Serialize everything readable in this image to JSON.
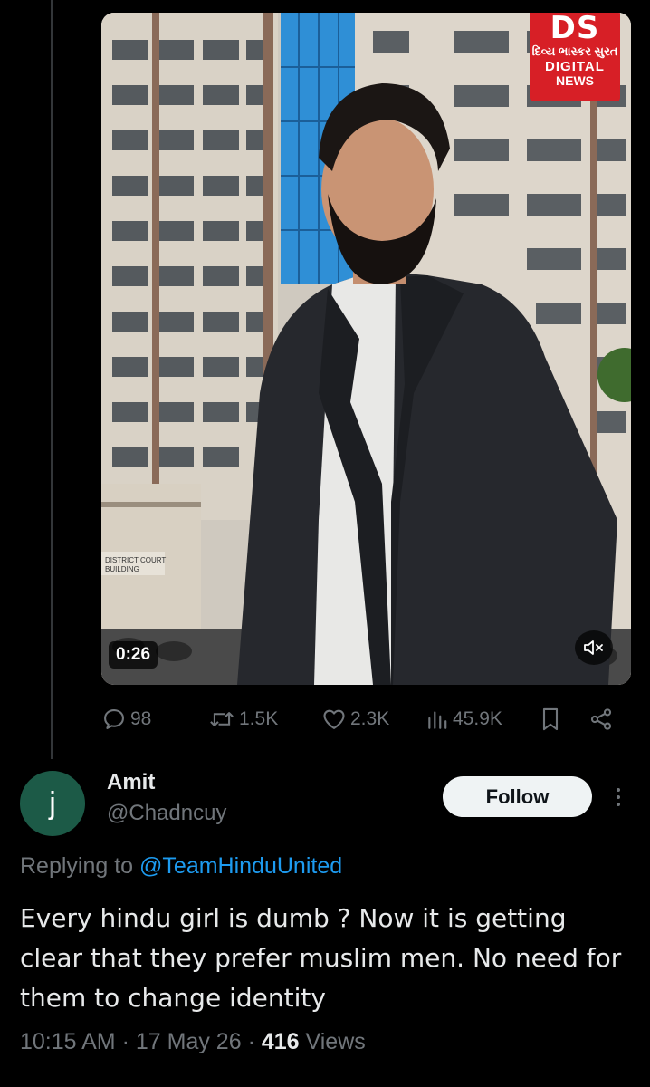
{
  "video": {
    "duration": "0:26",
    "logo": {
      "brand": "DS",
      "script_text": "દિવ્ય ભાસ્કર સુરત",
      "line1": "DIGITAL",
      "line2": "NEWS"
    },
    "building_sign": "DISTRICT COURT BUILDING",
    "colors": {
      "logo_bg": "#d71f26",
      "glass": "#2f8fd6"
    }
  },
  "actions": {
    "replies": "98",
    "reposts": "1.5K",
    "likes": "2.3K",
    "views": "45.9K"
  },
  "reply": {
    "avatar_letter": "j",
    "name": "Amit",
    "handle": "@Chadncuy",
    "follow_label": "Follow",
    "replying_prefix": "Replying to",
    "replying_to": "@TeamHinduUnited",
    "text": "Every hindu girl is dumb ? Now it is getting clear that they prefer muslim men. No need for them to change identity",
    "time": "10:15 AM",
    "date": "17 May 26",
    "views_count": "416",
    "views_label": "Views"
  },
  "colors": {
    "background": "#000000",
    "text": "#e7e9ea",
    "muted": "#71767b",
    "link": "#1d9bf0",
    "avatar_bg": "#1c5a47"
  }
}
